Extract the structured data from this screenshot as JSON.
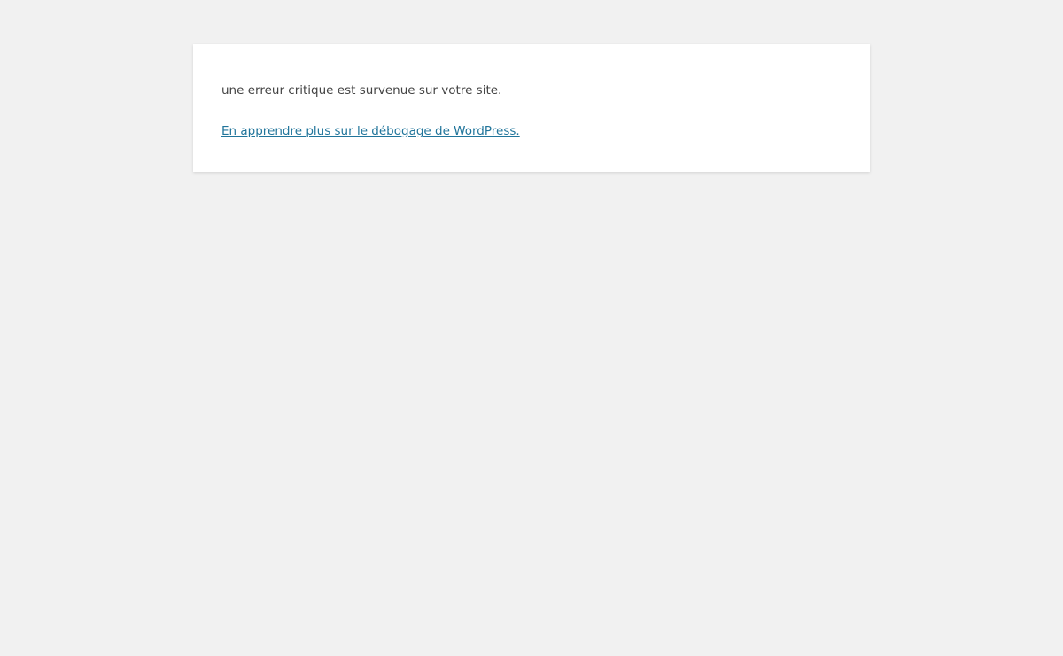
{
  "page": {
    "background_color": "#f1f1f1",
    "card_color": "#ffffff",
    "text_color": "#444444",
    "link_color": "#21759b"
  },
  "error": {
    "message": "une erreur critique est survenue sur votre site.",
    "link_label": "En apprendre plus sur le débogage de WordPress."
  }
}
